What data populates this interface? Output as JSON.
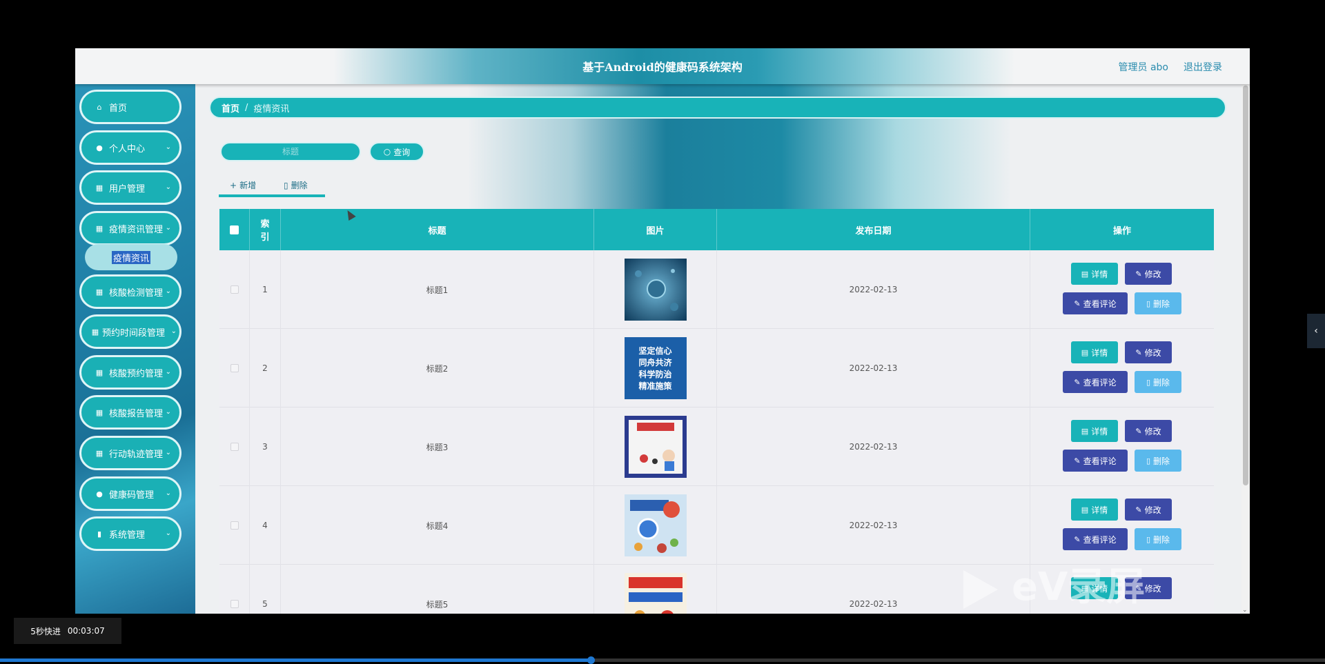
{
  "header": {
    "title": "基于Android的健康码系统架构",
    "user": "管理员 abo",
    "logout": "退出登录"
  },
  "sidebar": {
    "items": [
      {
        "label": "首页",
        "icon": "home-icon"
      },
      {
        "label": "个人中心",
        "icon": "user-icon"
      },
      {
        "label": "用户管理",
        "icon": "grid-icon"
      },
      {
        "label": "疫情资讯管理",
        "icon": "grid-icon"
      },
      {
        "label": "核酸检测管理",
        "icon": "grid-icon"
      },
      {
        "label": "预约时间段管理",
        "icon": "grid-icon"
      },
      {
        "label": "核酸预约管理",
        "icon": "grid-icon"
      },
      {
        "label": "核酸报告管理",
        "icon": "grid-icon"
      },
      {
        "label": "行动轨迹管理",
        "icon": "grid-icon"
      },
      {
        "label": "健康码管理",
        "icon": "pin-icon"
      },
      {
        "label": "系统管理",
        "icon": "chart-icon"
      }
    ],
    "active_sub": "疫情资讯"
  },
  "breadcrumb": {
    "home": "首页",
    "separator": "/",
    "current": "疫情资讯"
  },
  "search": {
    "placeholder": "标题",
    "button": "查询"
  },
  "toolbar": {
    "add": "新增",
    "delete": "删除"
  },
  "table": {
    "headers": {
      "index": "索引",
      "title": "标题",
      "image": "图片",
      "date": "发布日期",
      "actions": "操作"
    },
    "rows": [
      {
        "index": "1",
        "title": "标题1",
        "date": "2022-02-13"
      },
      {
        "index": "2",
        "title": "标题2",
        "date": "2022-02-13"
      },
      {
        "index": "3",
        "title": "标题3",
        "date": "2022-02-13"
      },
      {
        "index": "4",
        "title": "标题4",
        "date": "2022-02-13"
      },
      {
        "index": "5",
        "title": "标题5",
        "date": "2022-02-13"
      }
    ],
    "row_actions": {
      "detail": "详情",
      "edit": "修改",
      "review": "查看评论",
      "delete": "删除"
    },
    "image2_lines": [
      "坚定信心",
      "同舟共济",
      "科学防治",
      "精准施策"
    ]
  },
  "player": {
    "speed_label": "5秒快进",
    "time": "00:03:07",
    "progress": 0.446
  },
  "watermark": "eV录屏",
  "colors": {
    "accent": "#18b3b8",
    "indigo": "#3c4aa6",
    "light_blue": "#5ab9ec"
  }
}
